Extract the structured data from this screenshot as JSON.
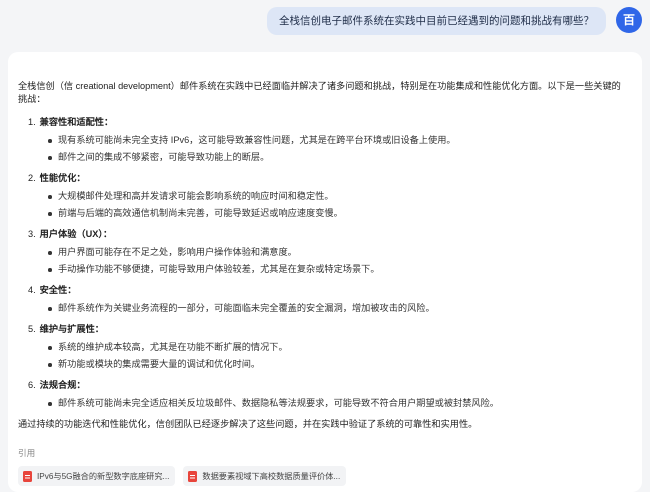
{
  "user": {
    "question": "全栈信创电子邮件系统在实践中目前已经遇到的问题和挑战有哪些？",
    "avatar_label": "百"
  },
  "answer": {
    "intro": "全栈信创（信 creational development）邮件系统在实践中已经面临并解决了诸多问题和挑战，特别是在功能集成和性能优化方面。以下是一些关键的挑战：",
    "sections": [
      {
        "num": "1.",
        "title": "兼容性和适配性：",
        "bullets": [
          "现有系统可能尚未完全支持 IPv6，这可能导致兼容性问题，尤其是在跨平台环境或旧设备上使用。",
          "邮件之间的集成不够紧密，可能导致功能上的断层。"
        ]
      },
      {
        "num": "2.",
        "title": "性能优化：",
        "bullets": [
          "大规模邮件处理和高并发请求可能会影响系统的响应时间和稳定性。",
          "前端与后端的高效通信机制尚未完善，可能导致延迟或响应速度变慢。"
        ]
      },
      {
        "num": "3.",
        "title": "用户体验（UX）：",
        "bullets": [
          "用户界面可能存在不足之处，影响用户操作体验和满意度。",
          "手动操作功能不够便捷，可能导致用户体验较差，尤其是在复杂或特定场景下。"
        ]
      },
      {
        "num": "4.",
        "title": "安全性：",
        "bullets": [
          "邮件系统作为关键业务流程的一部分，可能面临未完全覆盖的安全漏洞，增加被攻击的风险。"
        ]
      },
      {
        "num": "5.",
        "title": "维护与扩展性：",
        "bullets": [
          "系统的维护成本较高，尤其是在功能不断扩展的情况下。",
          "新功能或模块的集成需要大量的调试和优化时间。"
        ]
      },
      {
        "num": "6.",
        "title": "法规合规：",
        "bullets": [
          "邮件系统可能尚未完全适应相关反垃圾邮件、数据隐私等法规要求，可能导致不符合用户期望或被封禁风险。"
        ]
      }
    ],
    "summary": "通过持续的功能迭代和性能优化，信创团队已经逐步解决了这些问题，并在实践中验证了系统的可靠性和实用性。",
    "refs_label": "引用",
    "refs": [
      {
        "title": "IPv6与5G融合的新型数字底座研究...",
        "icon": "pdf-icon",
        "color": "#e8453c"
      },
      {
        "title": "数据要素视域下高校数据质量评价体...",
        "icon": "pdf-icon",
        "color": "#e8453c"
      }
    ]
  }
}
